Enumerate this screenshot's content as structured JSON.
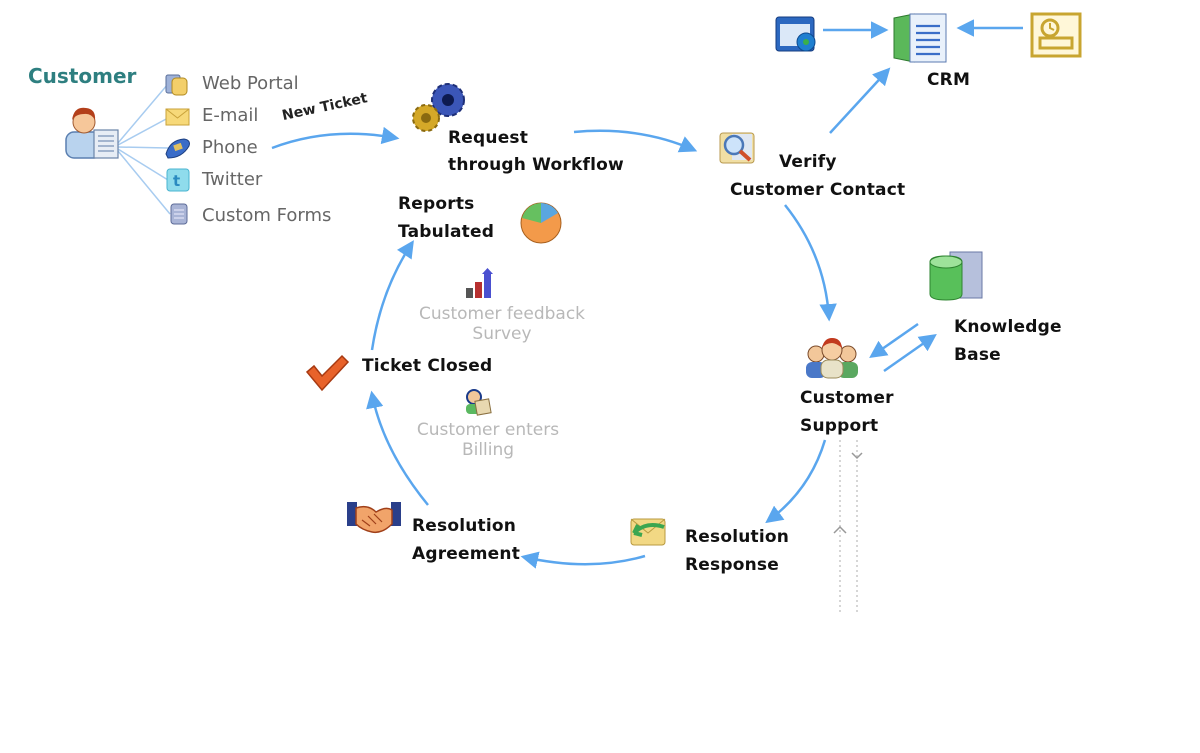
{
  "customer": {
    "title": "Customer",
    "channels": [
      {
        "label": "Web Portal",
        "icon": "web-portal-icon"
      },
      {
        "label": "E-mail",
        "icon": "envelope-icon"
      },
      {
        "label": "Phone",
        "icon": "phone-icon"
      },
      {
        "label": "Twitter",
        "icon": "twitter-icon"
      },
      {
        "label": "Custom Forms",
        "icon": "form-icon"
      }
    ]
  },
  "edge_labels": {
    "new_ticket": "New Ticket"
  },
  "nodes": {
    "request": {
      "line1": "Request",
      "line2": "through Workflow",
      "icon": "gears-icon"
    },
    "verify": {
      "line1": "Verify",
      "line2": "Customer Contact",
      "icon": "magnifier-icon"
    },
    "crm": {
      "label": "CRM",
      "icon": "crm-document-icon"
    },
    "knowledge_base": {
      "line1": "Knowledge",
      "line2": "Base",
      "icon": "database-icon"
    },
    "customer_support": {
      "line1": "Customer",
      "line2": "Support",
      "icon": "support-team-icon"
    },
    "resolution_response": {
      "line1": "Resolution",
      "line2": "Response",
      "icon": "mail-reply-icon"
    },
    "resolution_agreement": {
      "line1": "Resolution",
      "line2": "Agreement",
      "icon": "handshake-icon"
    },
    "ticket_closed": {
      "label": "Ticket Closed",
      "icon": "checkmark-icon"
    },
    "reports": {
      "line1": "Reports",
      "line2": "Tabulated",
      "icon": "pie-chart-icon"
    }
  },
  "faded_items": {
    "feedback": {
      "line1": "Customer feedback",
      "line2": "Survey",
      "icon": "bar-chart-icon"
    },
    "billing": {
      "line1": "Customer enters",
      "line2": "Billing",
      "icon": "user-billing-icon"
    }
  },
  "colors": {
    "arrow": "#5aa6ee",
    "customer_title": "#2e7f80",
    "channel_text": "#666666",
    "faded_text": "#b8b8b8"
  }
}
